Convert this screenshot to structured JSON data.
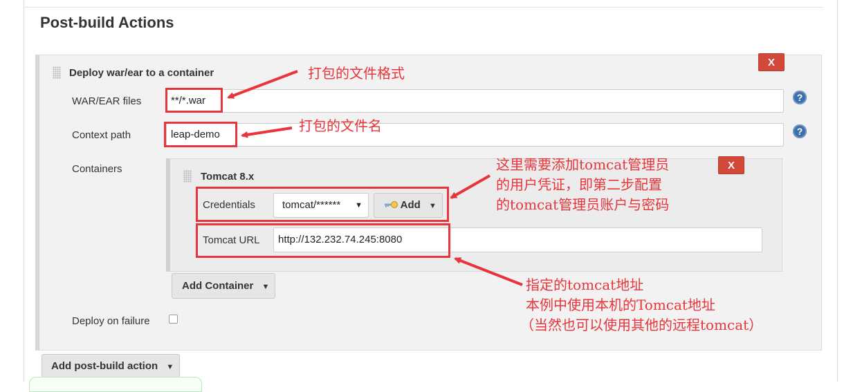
{
  "section": {
    "title": "Post-build Actions"
  },
  "deploy": {
    "title": "Deploy war/ear to a container",
    "remove_label": "X",
    "war_label": "WAR/EAR files",
    "war_value": "**/*.war",
    "context_label": "Context path",
    "context_value": "leap-demo",
    "containers_label": "Containers",
    "help_glyph": "?",
    "container": {
      "title": "Tomcat 8.x",
      "remove_label": "X",
      "credentials_label": "Credentials",
      "credentials_value": "tomcat/******",
      "add_label": "Add",
      "url_label": "Tomcat URL",
      "url_value": "http://132.232.74.245:8080"
    },
    "add_container_label": "Add Container",
    "deploy_on_failure_label": "Deploy on failure",
    "deploy_on_failure_checked": false
  },
  "add_post_build_label": "Add post-build action",
  "annotations": {
    "war": "打包的文件格式",
    "context": "打包的文件名",
    "credentials": [
      "这里需要添加tomcat管理员",
      "的用户凭证，即第二步配置",
      "的tomcat管理员账户与密码"
    ],
    "url": [
      "指定的tomcat地址",
      "本例中使用本机的Tomcat地址",
      "（当然也可以使用其他的远程tomcat）"
    ]
  },
  "colors": {
    "annotation": "#e8343a",
    "remove_button": "#d24939",
    "help": "#3f6fa8"
  }
}
